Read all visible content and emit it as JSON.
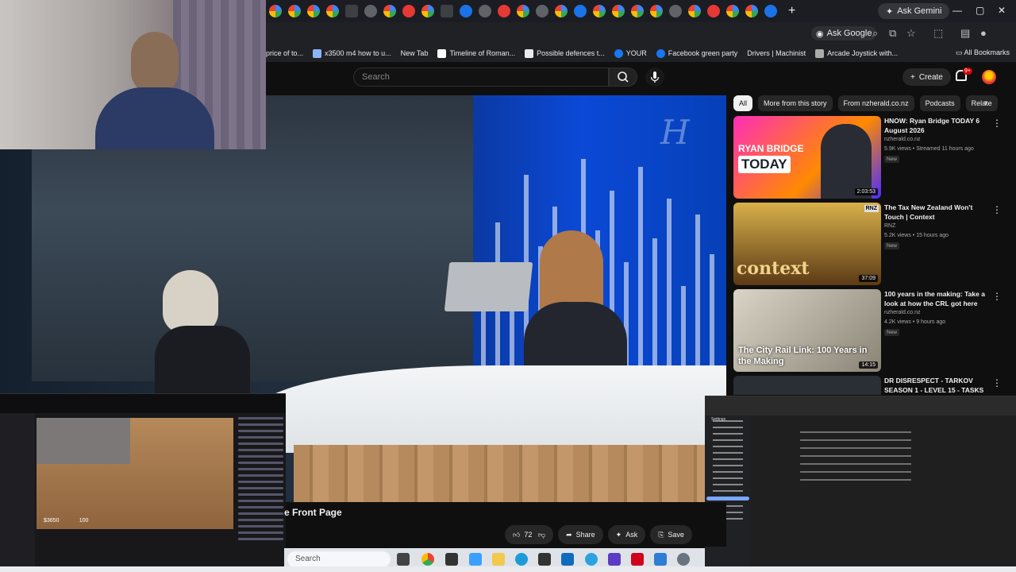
{
  "browser": {
    "gemini_label": "Ask Gemini",
    "ask_google_label": "Ask Google",
    "bookmarks": [
      "price of to...",
      "x3500 m4 how to u...",
      "New Tab",
      "Timeline of Roman...",
      "Possible defences t...",
      "YOUR",
      "Facebook green party",
      "Drivers | Machinist",
      "Arcade Joystick with..."
    ],
    "all_bookmarks": "All Bookmarks"
  },
  "youtube": {
    "search_placeholder": "Search",
    "create_label": "Create",
    "notif_badge": "9+",
    "video_title": "e Front Page",
    "like_count": "72",
    "share_label": "Share",
    "ask_label": "Ask",
    "save_label": "Save",
    "chips": [
      "All",
      "More from this story",
      "From nzherald.co.nz",
      "Podcasts",
      "Relate"
    ],
    "recommendations": [
      {
        "title": "HNOW: Ryan Bridge TODAY 6 August 2026",
        "channel": "nzherald.co.nz",
        "meta": "5.9K views • Streamed 11 hours ago",
        "badge": "New",
        "duration": "2:03:53",
        "thumb_line1": "RYAN BRIDGE",
        "thumb_line2": "TODAY"
      },
      {
        "title": "The Tax New Zealand Won't Touch | Context",
        "channel": "RNZ",
        "meta": "5.2K views • 15 hours ago",
        "badge": "New",
        "duration": "37:09",
        "thumb_text": "context",
        "thumb_tag": "RNZ"
      },
      {
        "title": "100 years in the making: Take a look at how the CRL got here",
        "channel": "nzherald.co.nz",
        "meta": "4.2K views • 9 hours ago",
        "badge": "New",
        "duration": "14:15",
        "thumb_text": "The City Rail Link: 100 Years in the Making"
      },
      {
        "title": "DR DISRESPECT - TARKOV SEASON 1 - LEVEL 15 - TASKS ..."
      }
    ]
  },
  "stream": {
    "health": "100",
    "money": "$3650"
  },
  "settings": {
    "title": "Settings"
  },
  "taskbar": {
    "search_placeholder": "Search"
  },
  "colors": {
    "youtube_bg": "#0f0f0f",
    "studio_blue": "#0b49d6",
    "notif_red": "#cc0000"
  }
}
